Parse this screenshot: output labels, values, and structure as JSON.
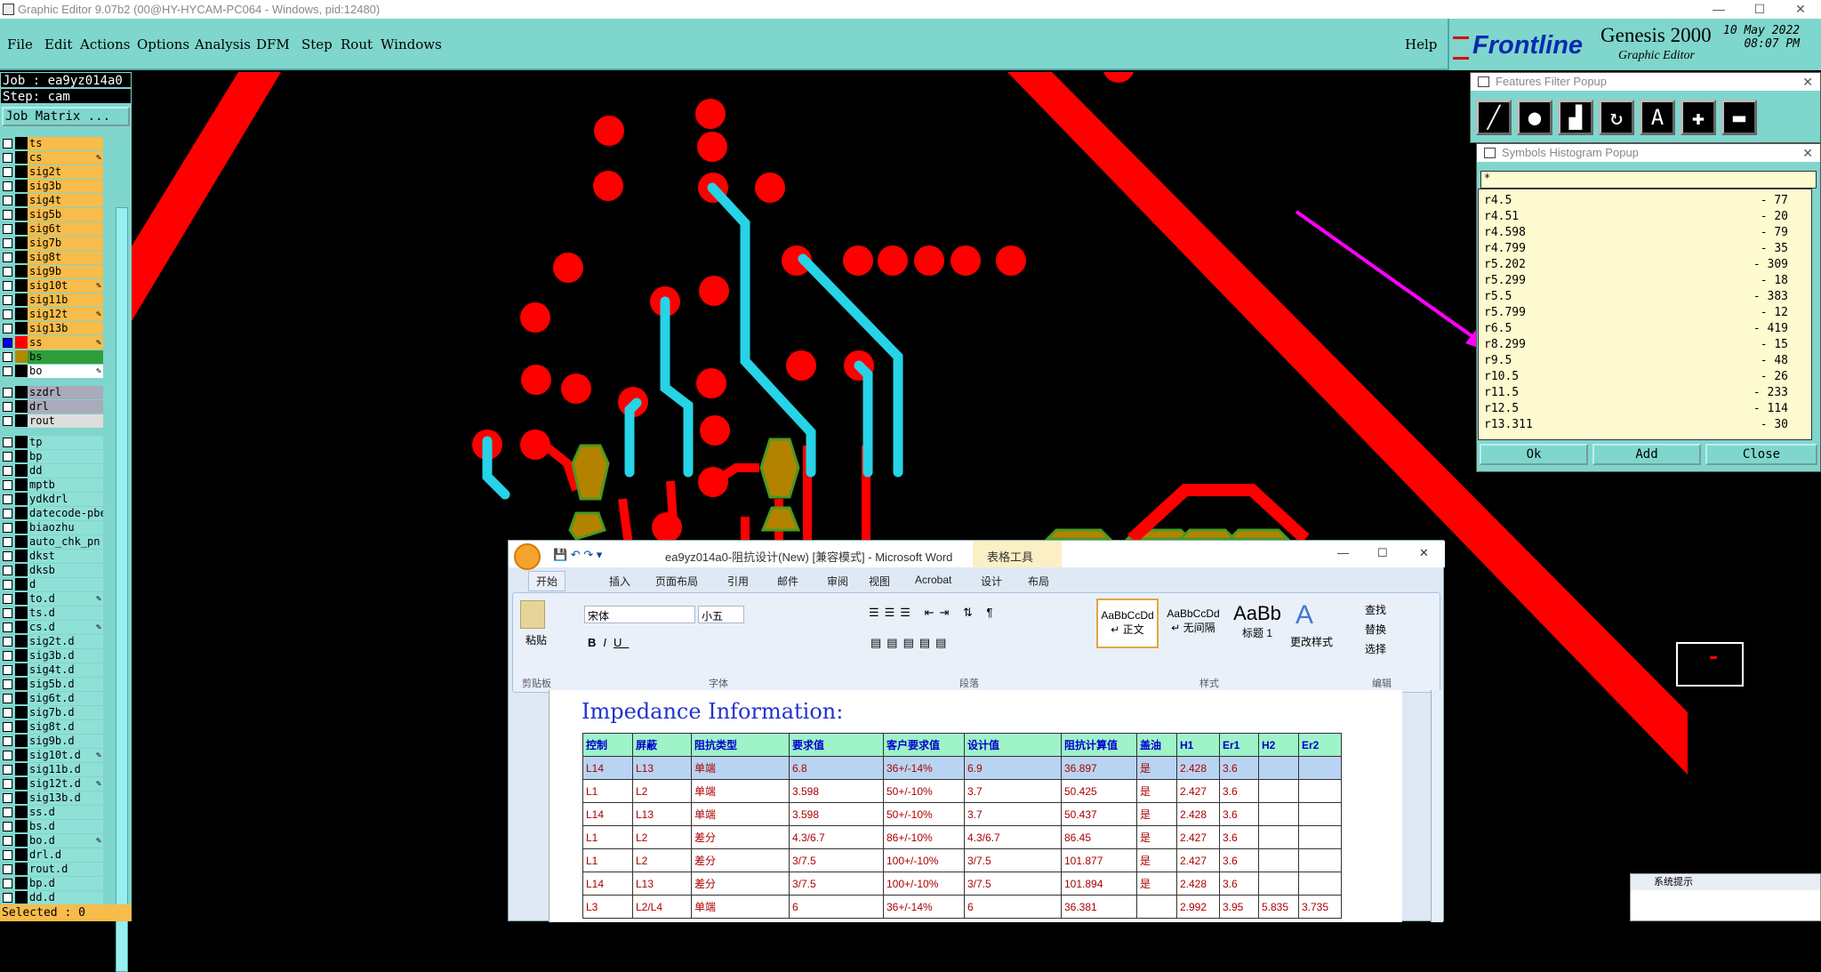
{
  "window": {
    "title": "Graphic Editor 9.07b2 (00@HY-HYCAM-PC064 - Windows, pid:12480)"
  },
  "menu": [
    "File",
    "Edit",
    "Actions",
    "Options",
    "Analysis",
    "DFM",
    "Step",
    "Rout",
    "Windows"
  ],
  "help": "Help",
  "logo": {
    "brand": "Frontline",
    "product": "Genesis 2000",
    "sub": "Graphic Editor",
    "date": "10 May 2022",
    "time": "08:07 PM"
  },
  "left": {
    "job": "Job : ea9yz014a0",
    "step": "Step: cam",
    "matrix": "Job Matrix ...",
    "selected": "Selected : 0",
    "layers": [
      {
        "name": "ts",
        "t": "sig",
        "c": "#000000"
      },
      {
        "name": "cs",
        "t": "sig",
        "c": "#000000",
        "m": true
      },
      {
        "name": "sig2t",
        "t": "sig",
        "c": "#000000"
      },
      {
        "name": "sig3b",
        "t": "sig",
        "c": "#000000"
      },
      {
        "name": "sig4t",
        "t": "sig",
        "c": "#000000"
      },
      {
        "name": "sig5b",
        "t": "sig",
        "c": "#000000"
      },
      {
        "name": "sig6t",
        "t": "sig",
        "c": "#000000"
      },
      {
        "name": "sig7b",
        "t": "sig",
        "c": "#000000"
      },
      {
        "name": "sig8t",
        "t": "sig",
        "c": "#000000"
      },
      {
        "name": "sig9b",
        "t": "sig",
        "c": "#000000"
      },
      {
        "name": "sig10t",
        "t": "sig",
        "c": "#000000",
        "m": true
      },
      {
        "name": "sig11b",
        "t": "sig",
        "c": "#000000"
      },
      {
        "name": "sig12t",
        "t": "sig",
        "c": "#000000",
        "m": true
      },
      {
        "name": "sig13b",
        "t": "sig",
        "c": "#000000"
      },
      {
        "name": "ss",
        "t": "sig",
        "c": "#ff0000",
        "m": true,
        "on": true
      },
      {
        "name": "bs",
        "t": "green",
        "c": "#b28a00"
      },
      {
        "name": "bo",
        "t": "white",
        "c": "#000000",
        "m": true
      },
      {
        "name": "",
        "t": "gap"
      },
      {
        "name": "szdrl",
        "t": "drl",
        "c": "#000000"
      },
      {
        "name": "drl",
        "t": "drl",
        "c": "#000000"
      },
      {
        "name": "rout",
        "t": "white2",
        "c": "#000000"
      },
      {
        "name": "",
        "t": "gap"
      },
      {
        "name": "tp",
        "t": "sol",
        "c": "#000000"
      },
      {
        "name": "bp",
        "t": "sol",
        "c": "#000000"
      },
      {
        "name": "dd",
        "t": "sol",
        "c": "#000000"
      },
      {
        "name": "mptb",
        "t": "sol",
        "c": "#000000"
      },
      {
        "name": "ydkdrl",
        "t": "sol",
        "c": "#000000"
      },
      {
        "name": "datecode-pbe",
        "t": "sol",
        "c": "#000000"
      },
      {
        "name": "biaozhu",
        "t": "sol",
        "c": "#000000"
      },
      {
        "name": "auto_chk_pn",
        "t": "sol",
        "c": "#000000"
      },
      {
        "name": "dkst",
        "t": "sol",
        "c": "#000000"
      },
      {
        "name": "dksb",
        "t": "sol",
        "c": "#000000"
      },
      {
        "name": "d",
        "t": "sol",
        "c": "#000000"
      },
      {
        "name": "to.d",
        "t": "sol",
        "c": "#000000",
        "m": true
      },
      {
        "name": "ts.d",
        "t": "sol",
        "c": "#000000"
      },
      {
        "name": "cs.d",
        "t": "sol",
        "c": "#000000",
        "m": true
      },
      {
        "name": "sig2t.d",
        "t": "sol",
        "c": "#000000"
      },
      {
        "name": "sig3b.d",
        "t": "sol",
        "c": "#000000"
      },
      {
        "name": "sig4t.d",
        "t": "sol",
        "c": "#000000"
      },
      {
        "name": "sig5b.d",
        "t": "sol",
        "c": "#000000"
      },
      {
        "name": "sig6t.d",
        "t": "sol",
        "c": "#000000"
      },
      {
        "name": "sig7b.d",
        "t": "sol",
        "c": "#000000"
      },
      {
        "name": "sig8t.d",
        "t": "sol",
        "c": "#000000"
      },
      {
        "name": "sig9b.d",
        "t": "sol",
        "c": "#000000"
      },
      {
        "name": "sig10t.d",
        "t": "sol",
        "c": "#000000",
        "m": true
      },
      {
        "name": "sig11b.d",
        "t": "sol",
        "c": "#000000"
      },
      {
        "name": "sig12t.d",
        "t": "sol",
        "c": "#000000",
        "m": true
      },
      {
        "name": "sig13b.d",
        "t": "sol",
        "c": "#000000"
      },
      {
        "name": "ss.d",
        "t": "sol",
        "c": "#000000"
      },
      {
        "name": "bs.d",
        "t": "sol",
        "c": "#000000"
      },
      {
        "name": "bo.d",
        "t": "sol",
        "c": "#000000",
        "m": true
      },
      {
        "name": "drl.d",
        "t": "sol",
        "c": "#000000"
      },
      {
        "name": "rout.d",
        "t": "sol",
        "c": "#000000"
      },
      {
        "name": "bp.d",
        "t": "sol",
        "c": "#000000"
      },
      {
        "name": "dd.d",
        "t": "sol",
        "c": "#000000"
      }
    ]
  },
  "features_popup": {
    "title": "Features Filter Popup"
  },
  "hist_popup": {
    "title": "Symbols Histogram Popup",
    "filter": "*",
    "rows": [
      [
        "r4.5",
        "77"
      ],
      [
        "r4.51",
        "20"
      ],
      [
        "r4.598",
        "79"
      ],
      [
        "r4.799",
        "35"
      ],
      [
        "r5.202",
        "309"
      ],
      [
        "r5.299",
        "18"
      ],
      [
        "r5.5",
        "383"
      ],
      [
        "r5.799",
        "12"
      ],
      [
        "r6.5",
        "419"
      ],
      [
        "r8.299",
        "15"
      ],
      [
        "r9.5",
        "48"
      ],
      [
        "r10.5",
        "26"
      ],
      [
        "r11.5",
        "233"
      ],
      [
        "r12.5",
        "114"
      ],
      [
        "r13.311",
        "30"
      ]
    ],
    "ok": "Ok",
    "add": "Add",
    "close": "Close"
  },
  "word": {
    "title": "ea9yz014a0-阻抗设计(New) [兼容模式] - Microsoft Word",
    "tools": "表格工具",
    "tabs": [
      "开始",
      "插入",
      "页面布局",
      "引用",
      "邮件",
      "审阅",
      "视图",
      "Acrobat",
      "设计",
      "布局"
    ],
    "groups": [
      "剪贴板",
      "字体",
      "段落",
      "样式",
      "编辑"
    ],
    "font": "宋体",
    "size": "小五",
    "paste": "粘贴",
    "styles": [
      [
        "AaBbCcDd",
        "↵ 正文"
      ],
      [
        "AaBbCcDd",
        "↵ 无间隔"
      ],
      [
        "AaBb",
        "标题 1"
      ]
    ],
    "change_style": "更改样式",
    "edit": [
      "查找",
      "替换",
      "选择"
    ],
    "heading": "Impedance Information:",
    "table_head": [
      "控制",
      "屏蔽",
      "阻抗类型",
      "要求值",
      "客户要求值",
      "设计值",
      "阻抗计算值",
      "盖油",
      "H1",
      "Er1",
      "H2",
      "Er2"
    ],
    "table_rows": [
      [
        "L14",
        "L13",
        "单端",
        "6.8",
        "36+/-14%",
        "6.9",
        "36.897",
        "是",
        "2.428",
        "3.6",
        "",
        ""
      ],
      [
        "L1",
        "L2",
        "单端",
        "3.598",
        "50+/-10%",
        "3.7",
        "50.425",
        "是",
        "2.427",
        "3.6",
        "",
        ""
      ],
      [
        "L14",
        "L13",
        "单端",
        "3.598",
        "50+/-10%",
        "3.7",
        "50.437",
        "是",
        "2.428",
        "3.6",
        "",
        ""
      ],
      [
        "L1",
        "L2",
        "差分",
        "4.3/6.7",
        "86+/-10%",
        "4.3/6.7",
        "86.45",
        "是",
        "2.427",
        "3.6",
        "",
        ""
      ],
      [
        "L1",
        "L2",
        "差分",
        "3/7.5",
        "100+/-10%",
        "3/7.5",
        "101.877",
        "是",
        "2.427",
        "3.6",
        "",
        ""
      ],
      [
        "L14",
        "L13",
        "差分",
        "3/7.5",
        "100+/-10%",
        "3/7.5",
        "101.894",
        "是",
        "2.428",
        "3.6",
        "",
        ""
      ],
      [
        "L3",
        "L2/L4",
        "单端",
        "6",
        "36+/-14%",
        "6",
        "36.381",
        "",
        "2.992",
        "3.95",
        "5.835",
        "3.735"
      ]
    ]
  },
  "sys": {
    "title": "系统提示"
  }
}
